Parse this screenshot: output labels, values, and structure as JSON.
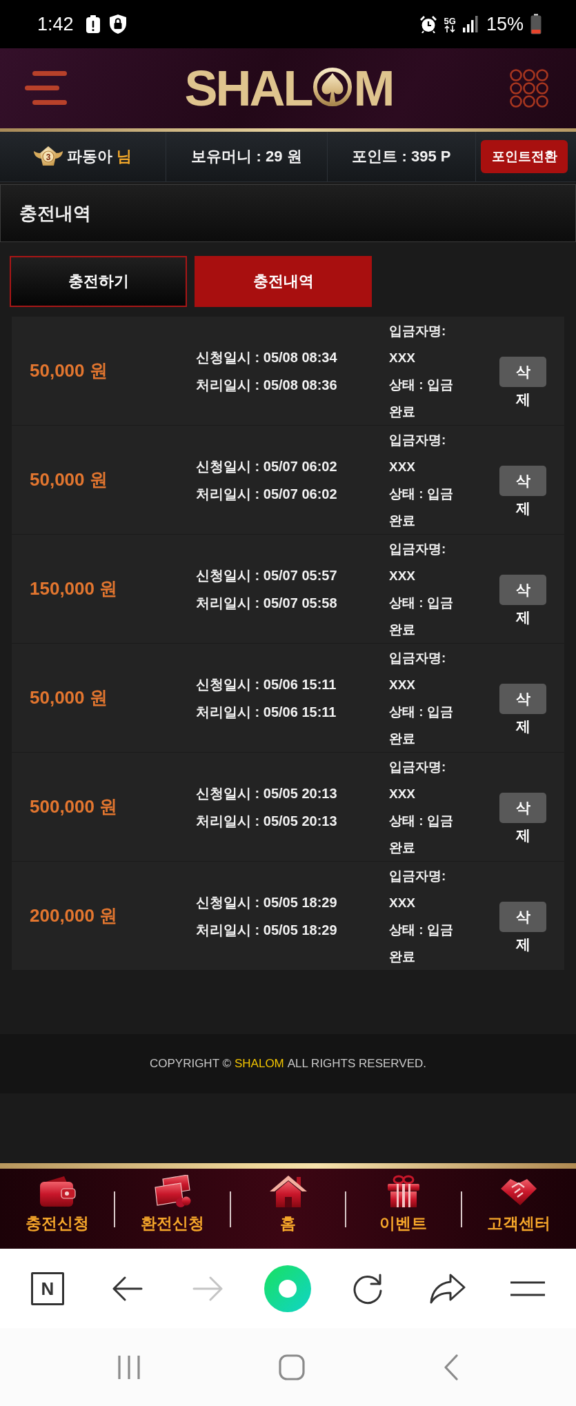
{
  "status_bar": {
    "time": "1:42",
    "network": "5G",
    "battery": "15%"
  },
  "header": {
    "logo_left": "SHAL",
    "logo_right": "M"
  },
  "user_bar": {
    "rank": "3",
    "username": "파동아",
    "honorific": "님",
    "balance": "보유머니 : 29 원",
    "points": "포인트 : 395 P",
    "convert_button": "포인트전환"
  },
  "page_title": "충전내역",
  "tabs": [
    {
      "label": "충전하기",
      "selected": false
    },
    {
      "label": "충전내역",
      "selected": true
    }
  ],
  "deposits": [
    {
      "amount": "50,000 원",
      "requested": "신청일시 : 05/08 08:34",
      "processed": "처리일시 : 05/08 08:36",
      "depositor": "입금자명: XXX",
      "status": "상태 : 입금완료",
      "delete_button": "삭제"
    },
    {
      "amount": "50,000 원",
      "requested": "신청일시 : 05/07 06:02",
      "processed": "처리일시 : 05/07 06:02",
      "depositor": "입금자명: XXX",
      "status": "상태 : 입금완료",
      "delete_button": "삭제"
    },
    {
      "amount": "150,000 원",
      "requested": "신청일시 : 05/07 05:57",
      "processed": "처리일시 : 05/07 05:58",
      "depositor": "입금자명: XXX",
      "status": "상태 : 입금완료",
      "delete_button": "삭제"
    },
    {
      "amount": "50,000 원",
      "requested": "신청일시 : 05/06 15:11",
      "processed": "처리일시 : 05/06 15:11",
      "depositor": "입금자명: XXX",
      "status": "상태 : 입금완료",
      "delete_button": "삭제"
    },
    {
      "amount": "500,000 원",
      "requested": "신청일시 : 05/05 20:13",
      "processed": "처리일시 : 05/05 20:13",
      "depositor": "입금자명: XXX",
      "status": "상태 : 입금완료",
      "delete_button": "삭제"
    },
    {
      "amount": "200,000 원",
      "requested": "신청일시 : 05/05 18:29",
      "processed": "처리일시 : 05/05 18:29",
      "depositor": "입금자명: XXX",
      "status": "상태 : 입금완료",
      "delete_button": "삭제"
    }
  ],
  "footer": {
    "copyright_prefix": "COPYRIGHT ©",
    "brand": "SHALOM",
    "copyright_suffix": "ALL RIGHTS RESERVED."
  },
  "bottom_nav": [
    {
      "label": "충전신청"
    },
    {
      "label": "환전신청"
    },
    {
      "label": "홈"
    },
    {
      "label": "이벤트"
    },
    {
      "label": "고객센터"
    }
  ],
  "browser_bar": {
    "home_label": "N",
    "forward_disabled": true
  }
}
